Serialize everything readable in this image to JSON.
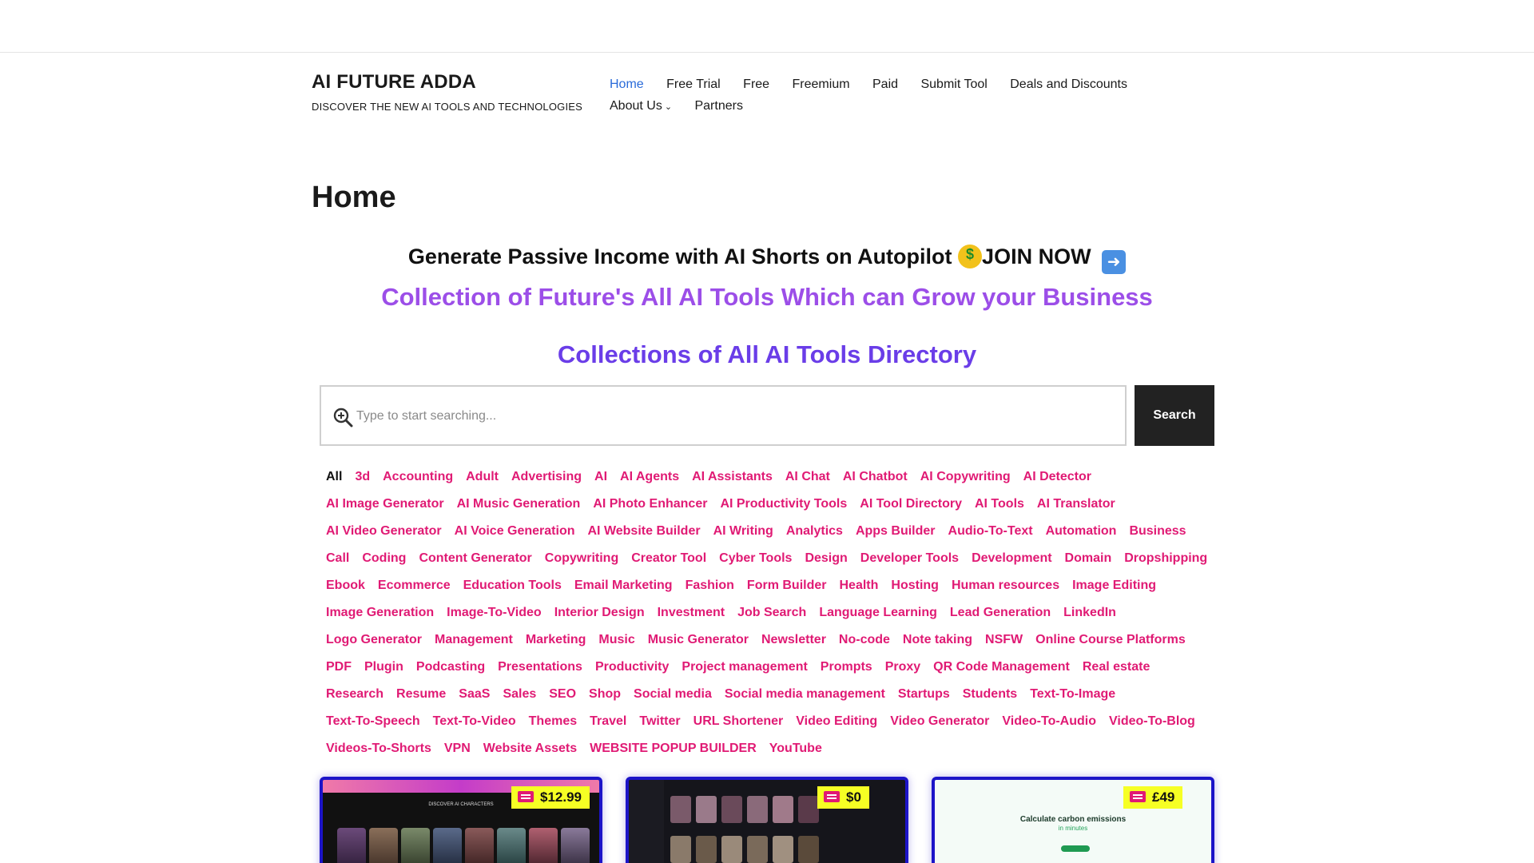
{
  "header": {
    "site_title": "AI FUTURE ADDA",
    "tagline": "DISCOVER THE NEW AI TOOLS AND TECHNOLOGIES",
    "nav": [
      {
        "label": "Home",
        "active": true
      },
      {
        "label": "Free Trial"
      },
      {
        "label": "Free"
      },
      {
        "label": "Freemium"
      },
      {
        "label": "Paid"
      },
      {
        "label": "Submit Tool"
      },
      {
        "label": "Deals and Discounts"
      },
      {
        "label": "About Us",
        "has_dropdown": true
      },
      {
        "label": "Partners"
      }
    ]
  },
  "page": {
    "title": "Home",
    "promo_text": "Generate Passive Income with AI Shorts on Autopilot",
    "promo_cta": "JOIN NOW",
    "subheading": "Collection of Future's All AI Tools Which can Grow your Business",
    "directory_heading": "Collections of All AI Tools Directory"
  },
  "search": {
    "placeholder": "Type to start searching...",
    "value": "",
    "button_label": "Search"
  },
  "tags": [
    "All",
    "3d",
    "Accounting",
    "Adult",
    "Advertising",
    "AI",
    "AI Agents",
    "AI Assistants",
    "AI Chat",
    "AI Chatbot",
    "AI Copywriting",
    "AI Detector",
    "AI Image Generator",
    "AI Music Generation",
    "AI Photo Enhancer",
    "AI Productivity Tools",
    "AI Tool Directory",
    "AI Tools",
    "AI Translator",
    "AI Video Generator",
    "AI Voice Generation",
    "AI Website Builder",
    "AI Writing",
    "Analytics",
    "Apps Builder",
    "Audio-To-Text",
    "Automation",
    "Business",
    "Call",
    "Coding",
    "Content Generator",
    "Copywriting",
    "Creator Tool",
    "Cyber Tools",
    "Design",
    "Developer Tools",
    "Development",
    "Domain",
    "Dropshipping",
    "Ebook",
    "Ecommerce",
    "Education Tools",
    "Email Marketing",
    "Fashion",
    "Form Builder",
    "Health",
    "Hosting",
    "Human resources",
    "Image Editing",
    "Image Generation",
    "Image-To-Video",
    "Interior Design",
    "Investment",
    "Job Search",
    "Language Learning",
    "Lead Generation",
    "LinkedIn",
    "Logo Generator",
    "Management",
    "Marketing",
    "Music",
    "Music Generator",
    "Newsletter",
    "No-code",
    "Note taking",
    "NSFW",
    "Online Course Platforms",
    "PDF",
    "Plugin",
    "Podcasting",
    "Presentations",
    "Productivity",
    "Project management",
    "Prompts",
    "Proxy",
    "QR Code Management",
    "Real estate",
    "Research",
    "Resume",
    "SaaS",
    "Sales",
    "SEO",
    "Shop",
    "Social media",
    "Social media management",
    "Startups",
    "Students",
    "Text-To-Image",
    "Text-To-Speech",
    "Text-To-Video",
    "Themes",
    "Travel",
    "Twitter",
    "URL Shortener",
    "Video Editing",
    "Video Generator",
    "Video-To-Audio",
    "Video-To-Blog",
    "Videos-To-Shorts",
    "VPN",
    "Website Assets",
    "WEBSITE POPUP BUILDER",
    "YouTube"
  ],
  "active_tag": "All",
  "cards": [
    {
      "price": "$12.99",
      "preview_heading": "DISCOVER AI CHARACTERS"
    },
    {
      "price": "$0",
      "preview_heading": ""
    },
    {
      "price": "£49",
      "preview_heading": "Calculate carbon emissions",
      "preview_sub": "in minutes"
    }
  ],
  "colors": {
    "accent_link": "#2a6bd9",
    "tag_pink": "#e01a74",
    "subheading_purple": "#9c4ee8",
    "directory_violet": "#6a3de8",
    "price_badge": "#f6ff24",
    "card_border": "#1c14c8",
    "search_button": "#222222"
  }
}
